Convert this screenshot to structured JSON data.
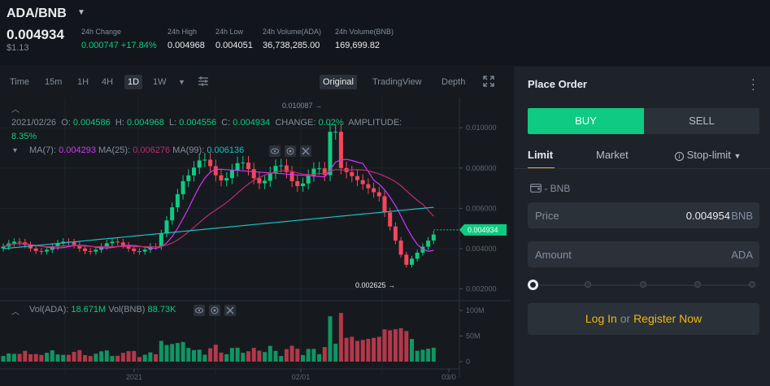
{
  "header": {
    "pair": "ADA/BNB",
    "last_price": "0.004934",
    "last_price_usd": "$1.13",
    "stats": [
      {
        "label": "24h Change",
        "value": "0.000747 +17.84%"
      },
      {
        "label": "24h High",
        "value": "0.004968"
      },
      {
        "label": "24h Low",
        "value": "0.004051"
      },
      {
        "label": "24h Volume(ADA)",
        "value": "36,738,285.00"
      },
      {
        "label": "24h Volume(BNB)",
        "value": "169,699.82"
      }
    ]
  },
  "toolbar": {
    "intervals": [
      "Time",
      "15m",
      "1H",
      "4H",
      "1D",
      "1W"
    ],
    "active_interval": "1D",
    "views": [
      "Original",
      "TradingView",
      "Depth"
    ],
    "active_view": "Original"
  },
  "legend": {
    "date": "2021/02/26",
    "o_label": "O:",
    "o": "0.004586",
    "h_label": "H:",
    "h": "0.004968",
    "l_label": "L:",
    "l": "0.004556",
    "c_label": "C:",
    "c": "0.004934",
    "change_label": "CHANGE:",
    "change": "0.02%",
    "amp_label": "AMPLITUDE:",
    "amp": "8.35%",
    "ma7_label": "MA(7):",
    "ma7": "0.004293",
    "ma25_label": "MA(25):",
    "ma25": "0.006276",
    "ma99_label": "MA(99):",
    "ma99": "0.006136",
    "vol_ada_label": "Vol(ADA):",
    "vol_ada": "18.671M",
    "vol_bnb_label": "Vol(BNB)",
    "vol_bnb": "88.73K"
  },
  "chart_data": {
    "type": "candlestick",
    "price_axis_ticks": [
      "0.010000",
      "0.008000",
      "0.006000",
      "0.004000",
      "0.002000"
    ],
    "price_ylim": [
      0.0015,
      0.0115
    ],
    "volume_axis_ticks": [
      "100M",
      "50M",
      "0"
    ],
    "volume_ylim": [
      0,
      100
    ],
    "x_tick_labels": [
      "2021",
      "02/01",
      "03/0"
    ],
    "current_price_tag": "0.004934",
    "high_annotation": "0.010087",
    "low_annotation": "0.002625",
    "colors": {
      "up": "#0ecb81",
      "down": "#f6465d",
      "ma7": "#d633ff",
      "ma25": "#c12b6a",
      "ma99": "#1dbfc3"
    }
  },
  "order": {
    "title": "Place Order",
    "buy_label": "BUY",
    "sell_label": "SELL",
    "tabs": [
      "Limit",
      "Market",
      "Stop-limit"
    ],
    "wallet_label": "- BNB",
    "price_label": "Price",
    "price_value": "0.004954",
    "price_unit": "BNB",
    "amount_label": "Amount",
    "amount_unit": "ADA",
    "login_label": "Log In",
    "or_label": "or",
    "register_label": "Register Now"
  }
}
